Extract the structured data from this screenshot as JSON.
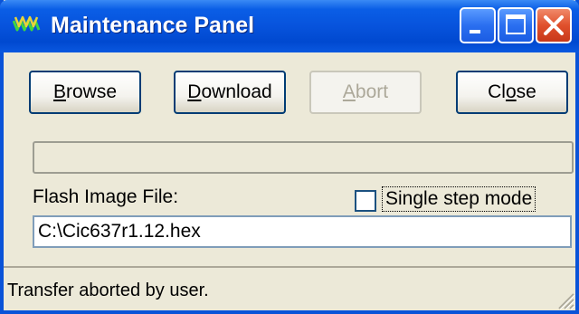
{
  "window": {
    "title": "Maintenance Panel",
    "title_icon": "signal-waves-icon",
    "title_bar_color": "#0753dc",
    "caption_buttons": [
      "minimize",
      "maximize",
      "close"
    ]
  },
  "toolbar": {
    "browse": {
      "pre": "",
      "ul": "B",
      "post": "rowse",
      "enabled": true
    },
    "download": {
      "pre": "",
      "ul": "D",
      "post": "ownload",
      "enabled": true
    },
    "abort": {
      "pre": "",
      "ul": "A",
      "post": "bort",
      "enabled": false
    },
    "close": {
      "pre": "Cl",
      "ul": "o",
      "post": "se",
      "enabled": true
    }
  },
  "progress": {
    "value": 0
  },
  "flash": {
    "label": "Flash Image File:",
    "value": "C:\\Cic637r1.12.hex"
  },
  "single_step": {
    "label": "Single step mode",
    "checked": false
  },
  "status": {
    "text": "Transfer aborted by user."
  }
}
